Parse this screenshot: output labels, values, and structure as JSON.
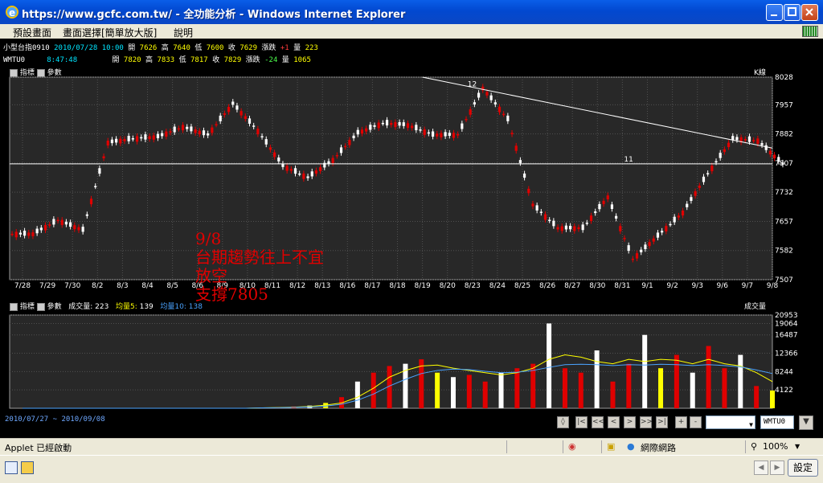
{
  "window": {
    "title": "https://www.gcfc.com.tw/ - 全功能分析 - Windows Internet Explorer"
  },
  "menu": {
    "items": [
      "預設畫面",
      "畫面選擇[簡單放大版]",
      "說明"
    ]
  },
  "quote": {
    "row1": {
      "name": "小型台指0910",
      "datetime": "2010/07/28 10:00",
      "open_label": "開",
      "open": "7626",
      "high_label": "高",
      "high": "7640",
      "low_label": "低",
      "low": "7600",
      "close_label": "收",
      "close": "7629",
      "change_label": "漲跌",
      "change": "+1",
      "volume_label": "量",
      "volume": "223"
    },
    "row2": {
      "name": "WMTU0",
      "datetime": "8:47:48",
      "open_label": "開",
      "open": "7820",
      "high_label": "高",
      "high": "7833",
      "low_label": "低",
      "low": "7817",
      "close_label": "收",
      "close": "7829",
      "change_label": "漲跌",
      "change": "-24",
      "volume_label": "量",
      "volume": "1065"
    }
  },
  "price_panel": {
    "indicator_label": "指標",
    "param_label": "參數",
    "period_label": "K線",
    "marker_high": "12",
    "marker_mid": "11"
  },
  "volume_panel": {
    "indicator_label": "指標",
    "param_label": "參數",
    "volume_label": "成交量",
    "volume_value": "223",
    "ma5_label": "均量5",
    "ma5_value": "139",
    "ma10_label": "均量10",
    "ma10_value": "138",
    "right_label": "成交量"
  },
  "annotation": {
    "lines": [
      "9/8",
      "台期趨勢往上不宜",
      "放空",
      "支撐7805"
    ]
  },
  "chart_data": [
    {
      "type": "candlestick",
      "title": "",
      "x_tick_labels": [
        "7/28",
        "7/29",
        "7/30",
        "8/2",
        "8/3",
        "8/4",
        "8/5",
        "8/6",
        "8/9",
        "8/10",
        "8/11",
        "8/12",
        "8/13",
        "8/16",
        "8/17",
        "8/18",
        "8/19",
        "8/20",
        "8/23",
        "8/24",
        "8/25",
        "8/26",
        "8/27",
        "8/30",
        "8/31",
        "9/1",
        "9/2",
        "9/3",
        "9/6",
        "9/7",
        "9/8"
      ],
      "y_tick_labels": [
        "8028",
        "7957",
        "7882",
        "7807",
        "7732",
        "7657",
        "7582",
        "7507"
      ],
      "ylim": [
        7507,
        8028
      ],
      "grid": true,
      "series": [
        {
          "name": "close",
          "values": [
            7625,
            7660,
            7635,
            7860,
            7870,
            7875,
            7900,
            7880,
            7960,
            7890,
            7800,
            7770,
            7815,
            7885,
            7910,
            7905,
            7880,
            7880,
            8000,
            7920,
            7700,
            7640,
            7640,
            7720,
            7560,
            7620,
            7680,
            7780,
            7870,
            7865,
            7805
          ]
        }
      ],
      "horizontal_lines": [
        7805
      ],
      "trendline": {
        "from": [
          "8/19",
          8028
        ],
        "to": [
          "9/8",
          7862
        ]
      }
    },
    {
      "type": "bar",
      "title": "",
      "y_tick_labels": [
        "20953",
        "19064",
        "16487",
        "12366",
        "8244",
        "4122"
      ],
      "ylim": [
        0,
        20953
      ],
      "series": [
        {
          "name": "成交量",
          "values": [
            0,
            0,
            0,
            0,
            0,
            0,
            0,
            0,
            0,
            0,
            0,
            0,
            0,
            0,
            0,
            120,
            200,
            400,
            600,
            1200,
            2500,
            6000,
            8000,
            9500,
            10000,
            11000,
            8000,
            7000,
            7500,
            6000,
            8000,
            9000,
            10000,
            19064,
            9000,
            8000,
            13000,
            6000,
            10000,
            16487,
            9000,
            12000,
            8000,
            14000,
            9000,
            12000,
            5000,
            4000
          ]
        },
        {
          "name": "均量5",
          "values": [
            0,
            0,
            0,
            0,
            0,
            0,
            0,
            0,
            0,
            0,
            0,
            0,
            0,
            0,
            0,
            100,
            150,
            250,
            400,
            700,
            1200,
            2500,
            4500,
            7000,
            8500,
            9500,
            9700,
            9000,
            8500,
            8000,
            7500,
            8000,
            9000,
            11000,
            12000,
            11500,
            10500,
            10000,
            11000,
            10500,
            11000,
            10800,
            10000,
            11000,
            10000,
            9500,
            8000,
            6000
          ]
        },
        {
          "name": "均量10",
          "values": [
            0,
            0,
            0,
            0,
            0,
            0,
            0,
            0,
            0,
            0,
            0,
            0,
            0,
            0,
            0,
            80,
            120,
            200,
            300,
            500,
            900,
            1800,
            3200,
            5000,
            6500,
            7800,
            8500,
            8800,
            8700,
            8300,
            8000,
            8100,
            8500,
            9200,
            9800,
            9900,
            9800,
            9600,
            9800,
            9700,
            9900,
            9800,
            9600,
            9800,
            9600,
            9300,
            8600,
            7800
          ]
        }
      ]
    }
  ],
  "navigator": {
    "date_range": "2010/07/27 ~ 2010/09/08",
    "buttons": [
      "|<",
      "<<",
      "<",
      ">",
      ">>",
      ">|",
      "+",
      "-"
    ],
    "code": "WMTU0"
  },
  "status": {
    "left": "Applet 已經啟動",
    "zone": "網際網路",
    "zoom": "100%"
  },
  "taskbar": {
    "settings_label": "設定"
  },
  "colors": {
    "up": "#e00000",
    "down": "#ffffff",
    "ma5": "#ffff00",
    "ma10": "#4aa3ff",
    "trend": "#ffffff"
  }
}
